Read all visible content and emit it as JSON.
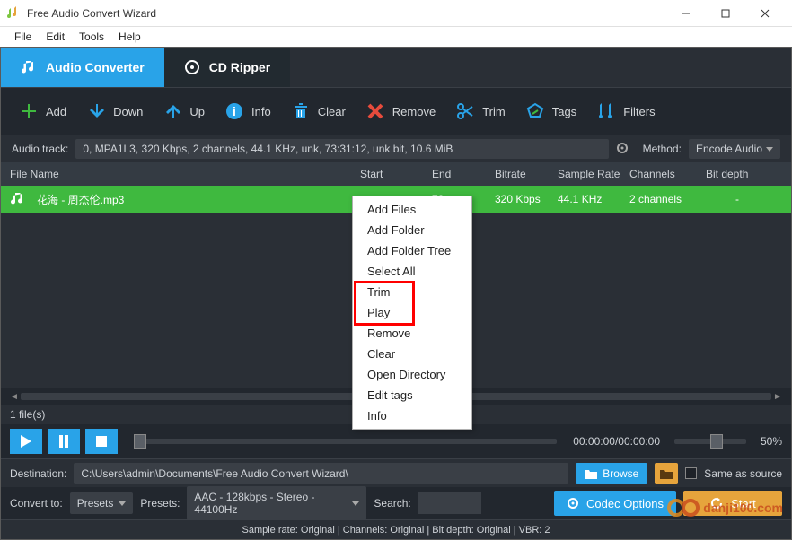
{
  "window": {
    "title": "Free Audio Convert Wizard"
  },
  "menu": {
    "file": "File",
    "edit": "Edit",
    "tools": "Tools",
    "help": "Help"
  },
  "tabs": {
    "converter": "Audio Converter",
    "ripper": "CD Ripper"
  },
  "toolbar": {
    "add": "Add",
    "down": "Down",
    "up": "Up",
    "info": "Info",
    "clear": "Clear",
    "remove": "Remove",
    "trim": "Trim",
    "tags": "Tags",
    "filters": "Filters"
  },
  "track": {
    "label": "Audio track:",
    "value": "0, MPA1L3, 320 Kbps, 2 channels, 44.1 KHz, unk, 73:31:12, unk bit, 10.6 MiB",
    "method_label": "Method:",
    "method_value": "Encode Audio"
  },
  "columns": {
    "name": "File Name",
    "start": "Start",
    "end": "End",
    "bitrate": "Bitrate",
    "sr": "Sample Rate",
    "ch": "Channels",
    "bd": "Bit depth"
  },
  "rows": [
    {
      "name": "花海 - 周杰伦.mp3",
      "start": "",
      "end": "72",
      "bitrate": "320 Kbps",
      "sr": "44.1 KHz",
      "ch": "2 channels",
      "bd": "-"
    }
  ],
  "file_count": "1 file(s)",
  "player": {
    "time": "00:00:00/00:00:00",
    "volume": "50%"
  },
  "dest": {
    "label": "Destination:",
    "path": "C:\\Users\\admin\\Documents\\Free Audio Convert Wizard\\",
    "browse": "Browse",
    "same": "Same as source"
  },
  "convert": {
    "label": "Convert to:",
    "presets_dd": "Presets",
    "presets_label": "Presets:",
    "preset_value": "AAC - 128kbps - Stereo - 44100Hz",
    "search_label": "Search:",
    "codec": "Codec Options",
    "start": "Start"
  },
  "status": "Sample rate: Original | Channels: Original | Bit depth: Original | VBR: 2",
  "context": {
    "add_files": "Add Files",
    "add_folder": "Add Folder",
    "add_tree": "Add Folder Tree",
    "select_all": "Select All",
    "trim": "Trim",
    "play": "Play",
    "remove": "Remove",
    "clear": "Clear",
    "open_dir": "Open Directory",
    "edit_tags": "Edit tags",
    "info": "Info"
  },
  "watermark": "danji100.com"
}
